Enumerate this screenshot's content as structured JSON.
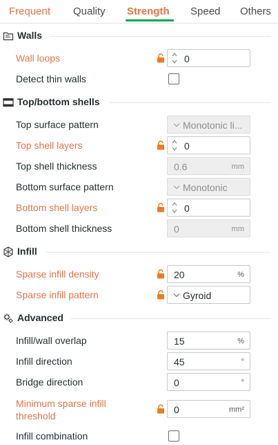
{
  "tabs": [
    {
      "label": "Frequent"
    },
    {
      "label": "Quality"
    },
    {
      "label": "Strength"
    },
    {
      "label": "Speed"
    },
    {
      "label": "Others"
    }
  ],
  "active_tab": "Strength",
  "colors": {
    "modified": "#e4744a",
    "active_underline": "#00a84d",
    "text": "#262e30"
  },
  "sections": {
    "walls": {
      "title": "Walls",
      "icon": "walls-icon",
      "wall_loops": {
        "label": "Wall loops",
        "value": "0",
        "modified": true
      },
      "detect_thin_walls": {
        "label": "Detect thin walls",
        "checked": false
      }
    },
    "shells": {
      "title": "Top/bottom shells",
      "icon": "shells-icon",
      "top_surface_pattern": {
        "label": "Top surface pattern",
        "value": "Monotonic li..."
      },
      "top_shell_layers": {
        "label": "Top shell layers",
        "value": "0",
        "modified": true
      },
      "top_shell_thickness": {
        "label": "Top shell thickness",
        "value": "0.6",
        "unit": "mm"
      },
      "bottom_surface_pattern": {
        "label": "Bottom surface pattern",
        "value": "Monotonic"
      },
      "bottom_shell_layers": {
        "label": "Bottom shell layers",
        "value": "0",
        "modified": true
      },
      "bottom_shell_thickness": {
        "label": "Bottom shell thickness",
        "value": "0",
        "unit": "mm"
      }
    },
    "infill": {
      "title": "Infill",
      "icon": "infill-icon",
      "sparse_infill_density": {
        "label": "Sparse infill density",
        "value": "20",
        "unit": "%",
        "modified": true
      },
      "sparse_infill_pattern": {
        "label": "Sparse infill pattern",
        "value": "Gyroid",
        "modified": true
      }
    },
    "advanced": {
      "title": "Advanced",
      "icon": "gears-icon",
      "infill_wall_overlap": {
        "label": "Infill/wall overlap",
        "value": "15",
        "unit": "%"
      },
      "infill_direction": {
        "label": "Infill direction",
        "value": "45",
        "unit": "°"
      },
      "bridge_direction": {
        "label": "Bridge direction",
        "value": "0",
        "unit": "°"
      },
      "min_sparse_infill_threshold": {
        "label": "Minimum sparse infill threshold",
        "value": "0",
        "unit": "mm²",
        "modified": true
      },
      "infill_combination": {
        "label": "Infill combination",
        "checked": false
      }
    }
  }
}
